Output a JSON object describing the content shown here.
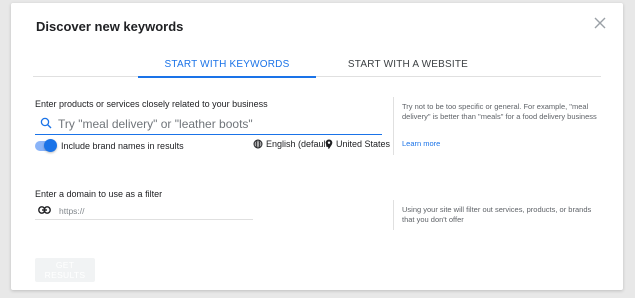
{
  "dialog": {
    "title": "Discover new keywords"
  },
  "tabs": [
    {
      "label": "START WITH KEYWORDS",
      "active": true
    },
    {
      "label": "START WITH A WEBSITE",
      "active": false
    }
  ],
  "keywords": {
    "label": "Enter products or services closely related to your business",
    "placeholder": "Try \"meal delivery\" or \"leather boots\"",
    "value": "",
    "toggle_label": "Include brand names in results",
    "toggle_on": true,
    "language": "English (default)",
    "location": "United States",
    "help": "Try not to be too specific or general. For example, \"meal delivery\" is better than \"meals\" for a food delivery business",
    "learn_more": "Learn more"
  },
  "domain_filter": {
    "label": "Enter a domain to use as a filter",
    "placeholder": "https://",
    "value": "",
    "help": "Using your site will filter out services, products, or brands that you don't offer"
  },
  "actions": {
    "get_results": "GET RESULTS",
    "get_results_enabled": false
  },
  "colors": {
    "accent": "#1a73e8",
    "toggle_track": "#8ab4f8",
    "disabled_button": "#f1f3f4"
  }
}
